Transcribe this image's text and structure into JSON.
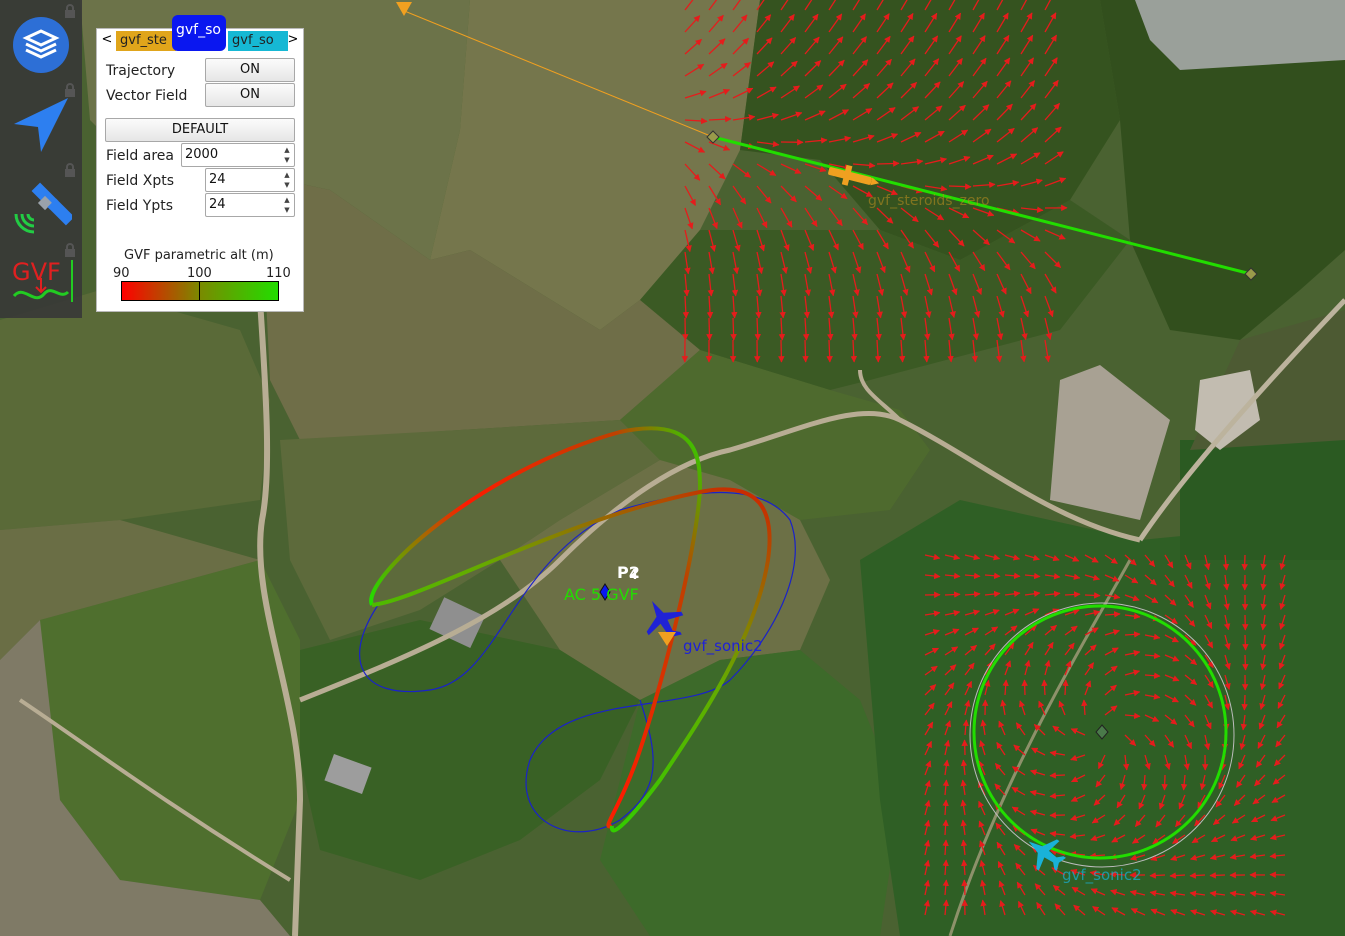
{
  "panel": {
    "prev_arrow": "<",
    "next_arrow": ">",
    "tabs": [
      {
        "label": "gvf_ste",
        "color": "#e0a51b"
      },
      {
        "label": "gvf_so",
        "color": "#0a17f0"
      },
      {
        "label": "gvf_so",
        "color": "#16b8d4"
      }
    ],
    "trajectory_label": "Trajectory",
    "trajectory_state": "ON",
    "vector_field_label": "Vector Field",
    "vector_field_state": "ON",
    "default_button": "DEFAULT",
    "field_area_label": "Field area",
    "field_area_value": "2000",
    "field_xpts_label": "Field Xpts",
    "field_xpts_value": "24",
    "field_ypts_label": "Field Ypts",
    "field_ypts_value": "24",
    "colorbar": {
      "title": "GVF parametric alt (m)",
      "min_label": "90",
      "mid_label": "100",
      "max_label": "110",
      "colors": [
        "#ff0000",
        "#7a8a00",
        "#22dd00"
      ]
    }
  },
  "toolbar": {
    "icons": [
      "layers-icon",
      "navigation-icon",
      "satellite-icon",
      "gvf-icon"
    ],
    "gvf_icon_text": "GVF",
    "lock_icon": "lock-icon"
  },
  "map": {
    "waypoint_p2": "P2",
    "waypoint_p4": "4",
    "ac_label": "AC 5 GVF",
    "aircraft1_label": "gvf_sonic2",
    "aircraft2_label": "gvf_sonic2",
    "aircraft3_label": "gvf_steroids_zero",
    "colors": {
      "blue_aircraft": "#1f22d6",
      "cyan_aircraft": "#19b2d8",
      "orange_aircraft": "#f0a020",
      "vector_field": "#e51c1c",
      "trajectory_green": "#22dd00",
      "track_blue": "#1a22c8"
    }
  }
}
